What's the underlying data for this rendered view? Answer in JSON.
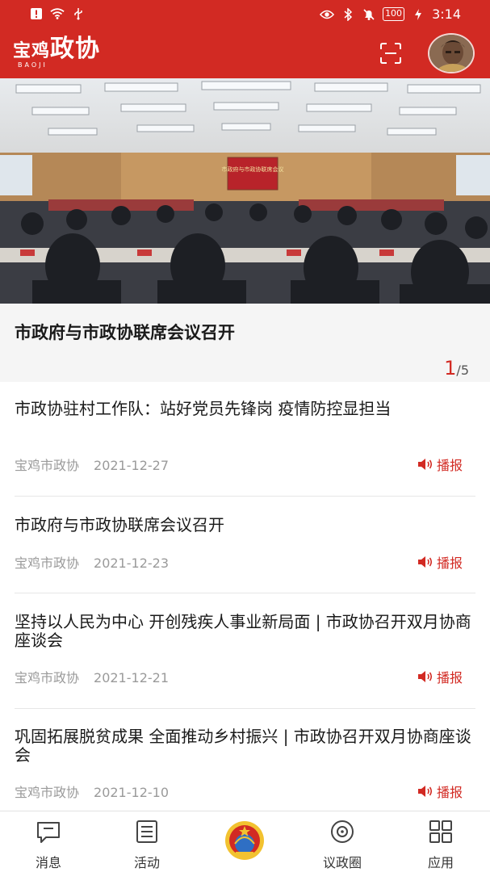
{
  "status_bar": {
    "battery": "100",
    "time": "3:14"
  },
  "header": {
    "logo_city": "宝鸡",
    "logo_name": "政协",
    "logo_sub": "BAOJI"
  },
  "banner": {
    "title": "市政府与市政协联席会议召开",
    "page_current": "1",
    "page_total": "/5",
    "screen_text": "市政府与市政协联席会议"
  },
  "news": [
    {
      "title": "市政协驻村工作队：站好党员先锋岗 疫情防控显担当",
      "source": "宝鸡市政协",
      "date": "2021-12-27",
      "action": "播报"
    },
    {
      "title": "市政府与市政协联席会议召开",
      "source": "宝鸡市政协",
      "date": "2021-12-23",
      "action": "播报"
    },
    {
      "title": "坚持以人民为中心 开创残疾人事业新局面 | 市政协召开双月协商座谈会",
      "source": "宝鸡市政协",
      "date": "2021-12-21",
      "action": "播报"
    },
    {
      "title": "巩固拓展脱贫成果 全面推动乡村振兴 | 市政协召开双月协商座谈会",
      "source": "宝鸡市政协",
      "date": "2021-12-10",
      "action": "播报"
    }
  ],
  "bottom_nav": {
    "messages": "消息",
    "activities": "活动",
    "circle": "议政圈",
    "apps": "应用"
  },
  "colors": {
    "brand_red": "#d22a23",
    "meta_gray": "#9a9a9a"
  }
}
